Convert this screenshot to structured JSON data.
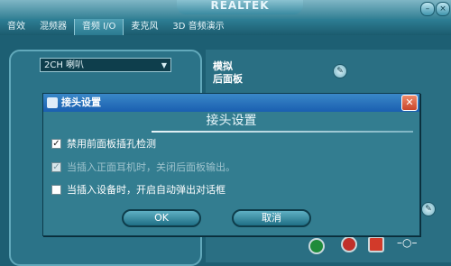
{
  "app": {
    "logo_text": "REALTEK"
  },
  "tabs": [
    {
      "label": "音效"
    },
    {
      "label": "混频器"
    },
    {
      "label": "音频 I/O"
    },
    {
      "label": "麦克风"
    },
    {
      "label": "3D 音频演示"
    }
  ],
  "device_dropdown": {
    "value": "2CH 喇叭"
  },
  "analog": {
    "line1": "模拟",
    "line2": "后面板"
  },
  "dialog": {
    "title": "接头设置",
    "heading": "接头设置",
    "options": [
      {
        "label": "禁用前面板插孔检测",
        "checked": true,
        "enabled": true
      },
      {
        "label": "当插入正面耳机时，关闭后面板输出。",
        "checked": true,
        "enabled": false
      },
      {
        "label": "当插入设备时，开启自动弹出对话框",
        "checked": false,
        "enabled": true
      }
    ],
    "ok_label": "OK",
    "cancel_label": "取消"
  },
  "colors": {
    "background": "#1d5f73",
    "dialog": "#337d90",
    "titlebar": "#1a5fb0",
    "accent": "#62a9bb"
  }
}
